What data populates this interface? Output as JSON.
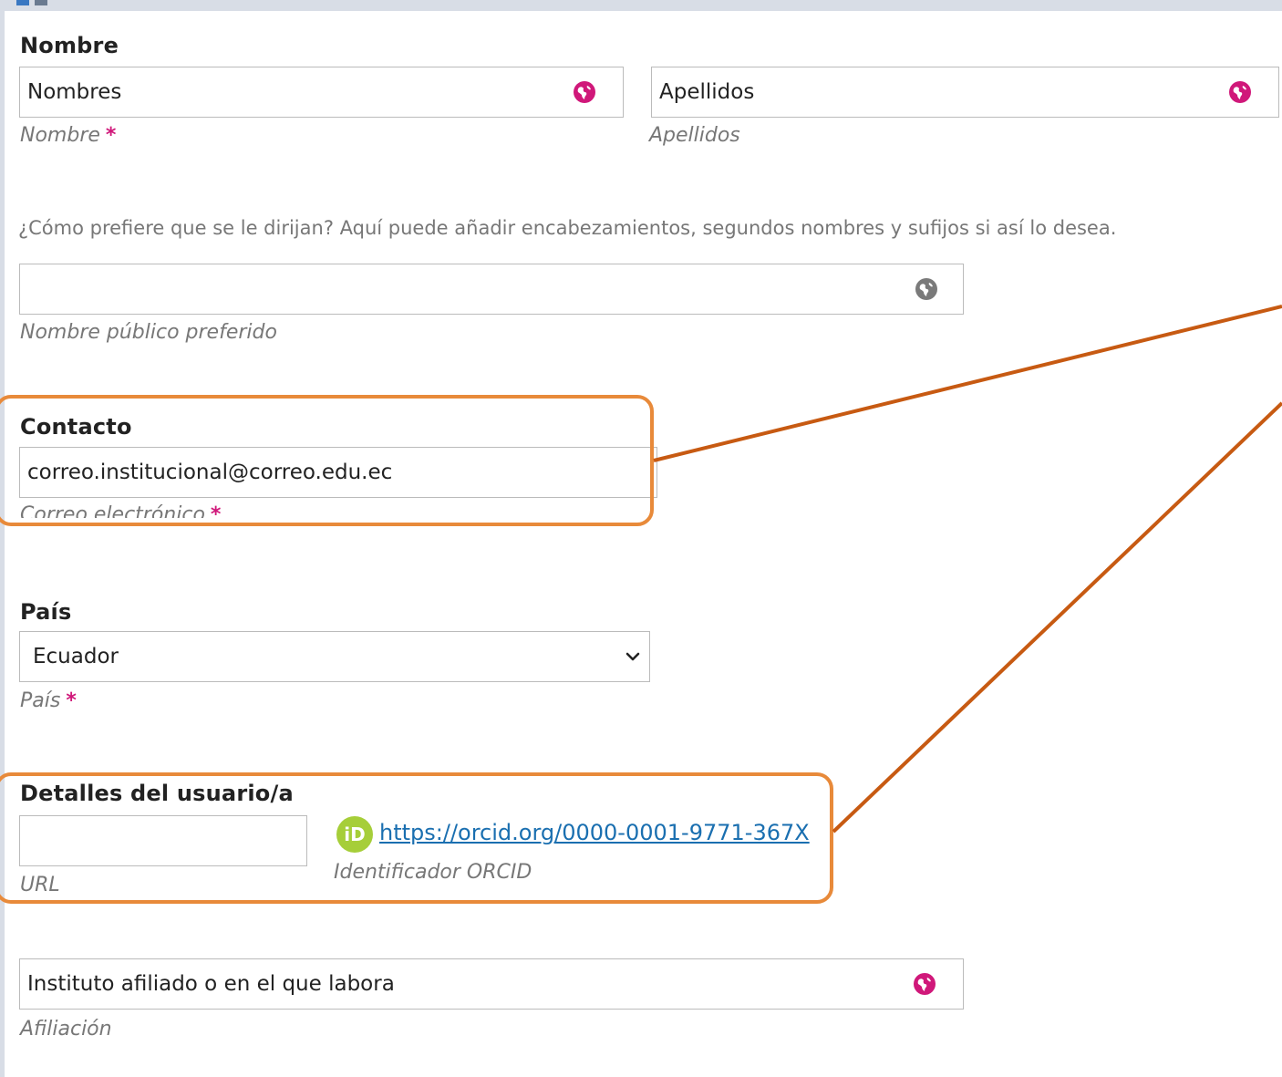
{
  "colors": {
    "accent": "#d0187a",
    "callout_border": "#e88a3a",
    "connector_line": "#c75a12",
    "link": "#1a6fb0",
    "orcid_green": "#a6ce39"
  },
  "name_section": {
    "heading": "Nombre",
    "given_name": {
      "value": "Nombres",
      "hint": "Nombre",
      "required": "*",
      "icon": "globe-icon"
    },
    "family_name": {
      "value": "Apellidos",
      "hint": "Apellidos",
      "icon": "globe-icon"
    }
  },
  "preferred_name": {
    "description": "¿Cómo prefiere que se le dirijan? Aquí puede añadir encabezamientos, segundos nombres y sufijos si así lo desea.",
    "value": "",
    "hint": "Nombre público preferido",
    "icon": "globe-icon"
  },
  "contact_section": {
    "heading": "Contacto",
    "email": {
      "value": "correo.institucional@correo.edu.ec",
      "hint": "Correo electrónico",
      "required": "*"
    }
  },
  "country_section": {
    "heading": "País",
    "country": {
      "value": "Ecuador",
      "hint": "País",
      "required": "*",
      "icon": "chevron-down-icon"
    }
  },
  "user_details": {
    "heading": "Detalles del usuario/a",
    "url": {
      "value": "",
      "hint": "URL"
    },
    "orcid": {
      "badge": "iD",
      "link": "https://orcid.org/0000-0001-9771-367X",
      "hint": "Identificador ORCID"
    }
  },
  "affiliation": {
    "value": "Instituto afiliado o en el que labora",
    "hint": "Afiliación",
    "icon": "globe-icon"
  }
}
